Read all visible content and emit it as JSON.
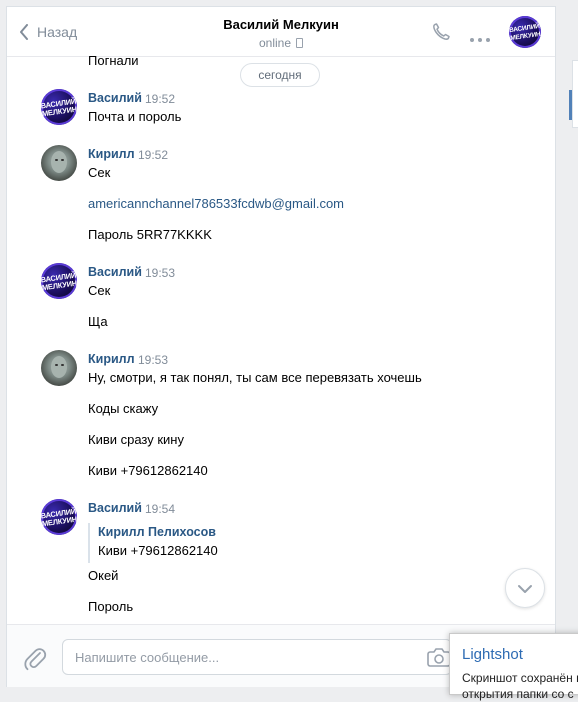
{
  "header": {
    "back_label": "Назад",
    "contact_name": "Василий Мелкуин",
    "status": "online"
  },
  "conversation": {
    "prev_tail": "Погнали",
    "date_separator": "сегодня",
    "avatar_text_v": "ВАСИЛИЙ МЕЛКУИН",
    "groups": [
      {
        "author": "Василий",
        "time": "19:52",
        "lines": [
          "Почта и пороль"
        ]
      },
      {
        "author": "Кирилл",
        "time": "19:52",
        "lines": [
          "Сек",
          "americannchannel786533fcdwb@gmail.com",
          "Пароль 5RR77KKKK"
        ]
      },
      {
        "author": "Василий",
        "time": "19:53",
        "lines": [
          "Сек",
          "Ща"
        ]
      },
      {
        "author": "Кирилл",
        "time": "19:53",
        "lines": [
          "Ну, смотри, я так понял, ты сам все перевязать хочешь",
          "Коды скажу",
          "Киви сразу кину",
          "Киви +79612862140"
        ]
      },
      {
        "author": "Василий",
        "time": "19:54",
        "quote_author": "Кирилл Пелихосов",
        "quote_text": "Киви +79612862140",
        "lines": [
          "Окей",
          "Пороль"
        ]
      }
    ]
  },
  "composer": {
    "placeholder": "Напишите сообщение..."
  },
  "lightshot": {
    "title": "Lightshot",
    "line1": "Скриншот сохранён в",
    "line2": "открытия папки со с"
  },
  "colors": {
    "link": "#2a5885",
    "muted": "#818c99",
    "background": "#edeef0"
  }
}
